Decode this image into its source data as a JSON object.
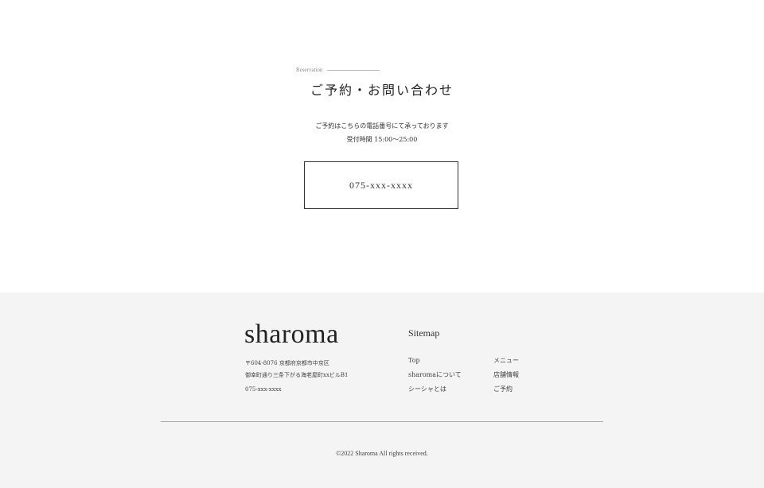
{
  "reservation": {
    "eyebrow": "Reservation",
    "title": "ご予約・お問い合わせ",
    "description_line1": "ご予約はこちらの電話番号にて承っております",
    "description_line2": "受付時間 15:00～25:00",
    "phone": "075-xxx-xxxx"
  },
  "footer": {
    "brand": "sharoma",
    "address_line1": "〒604-8076 京都府京都市中京区",
    "address_line2": "御幸町通り三条下がる海老屋町xxビルB1",
    "tel": "075-xxx-xxxx",
    "sitemap_title": "Sitemap",
    "sitemap": {
      "col1": [
        "Top",
        "sharomaについて",
        "シーシャとは"
      ],
      "col2": [
        "メニュー",
        "店舗情報",
        "ご予約"
      ]
    },
    "copyright": "©2022 Sharoma All rights received."
  }
}
